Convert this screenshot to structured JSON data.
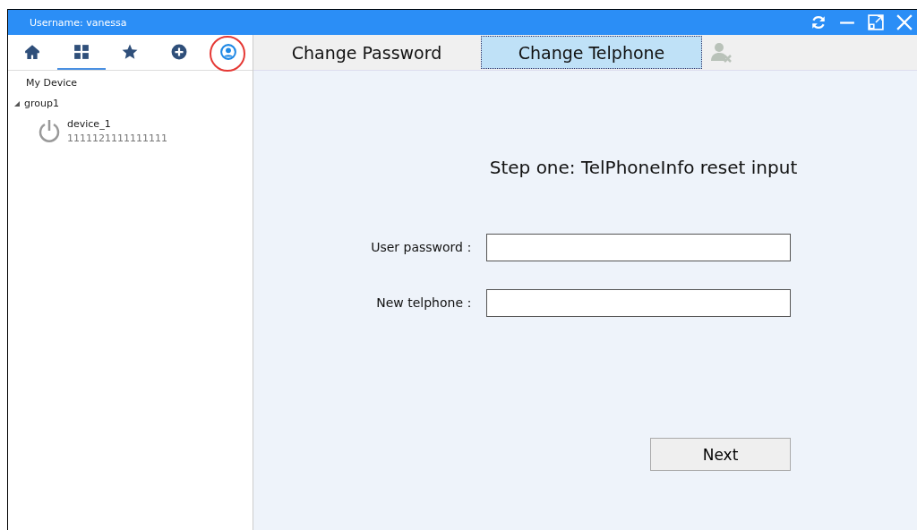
{
  "window": {
    "title": "Username: vanessa"
  },
  "title_buttons": [
    {
      "kind": "refresh"
    },
    {
      "kind": "minimize"
    },
    {
      "kind": "maximize"
    },
    {
      "kind": "close"
    }
  ],
  "nav": [
    {
      "kind": "home",
      "selected": false,
      "highlighted": false,
      "circled": false
    },
    {
      "kind": "grid",
      "selected": true,
      "highlighted": false,
      "circled": false
    },
    {
      "kind": "star",
      "selected": false,
      "highlighted": false,
      "circled": false
    },
    {
      "kind": "add",
      "selected": false,
      "highlighted": false,
      "circled": false
    },
    {
      "kind": "user",
      "selected": false,
      "highlighted": true,
      "circled": true
    }
  ],
  "tree": {
    "title": "My Device",
    "groups": [
      {
        "label": "group1",
        "expanded": true,
        "children": [
          {
            "name": "device_1",
            "serial": "1111121111111111"
          }
        ]
      }
    ]
  },
  "tabs": [
    {
      "label": "Change Password",
      "selected": false
    },
    {
      "label": "Change Telphone",
      "selected": true
    },
    {
      "kind": "user-remove",
      "disabled": true
    }
  ],
  "form": {
    "heading": "Step one: TelPhoneInfo reset input",
    "fields": [
      {
        "label": "User password："
      },
      {
        "label": "New telphone："
      }
    ],
    "button": "Next"
  }
}
